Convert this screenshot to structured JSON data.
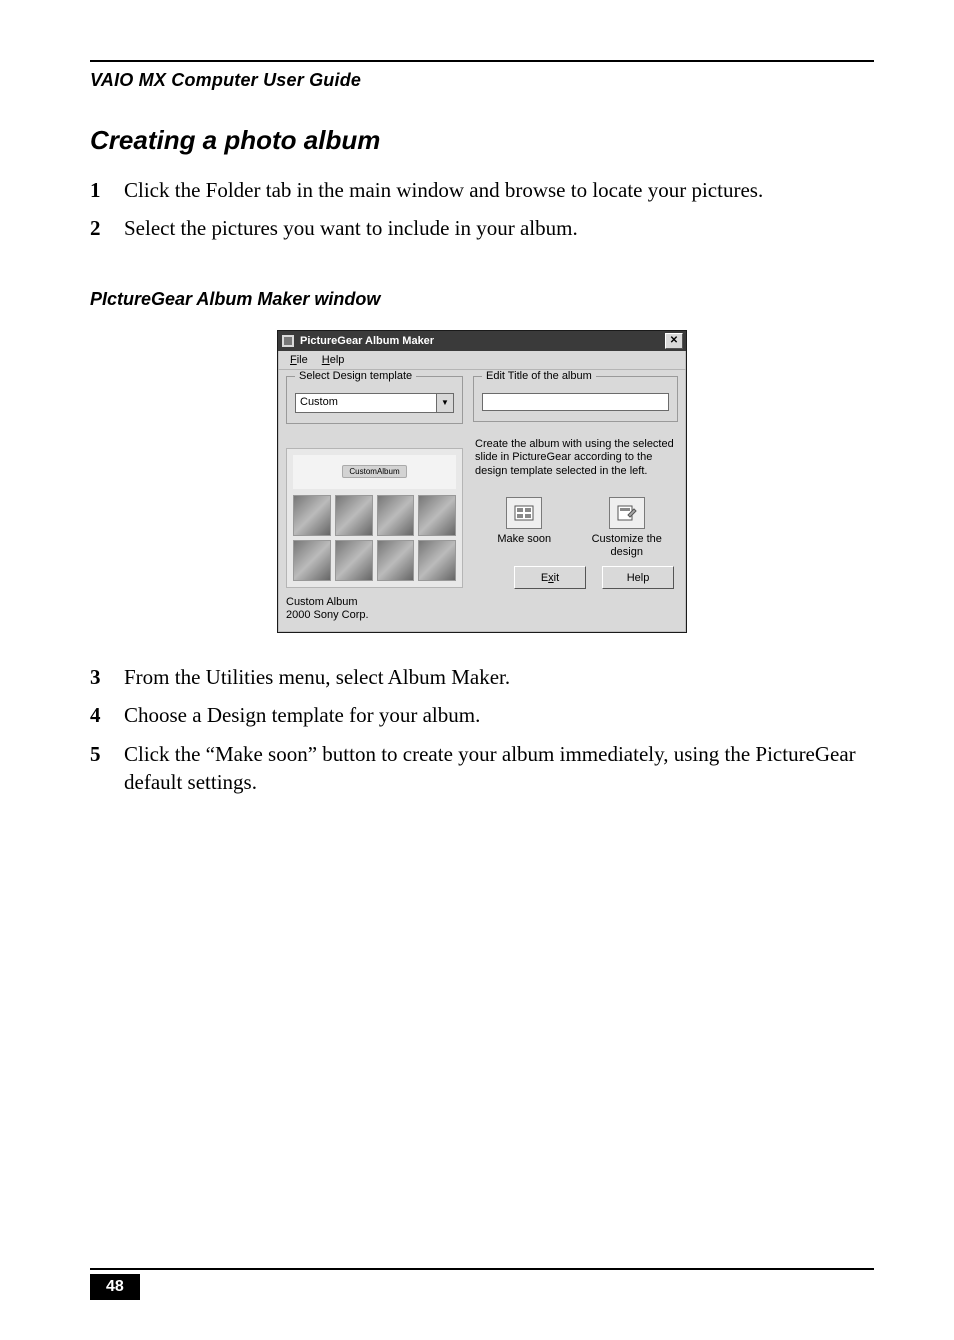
{
  "page": {
    "header": "VAIO MX Computer User Guide",
    "section_title": "Creating a photo album",
    "steps_top": [
      {
        "n": "1",
        "t": "Click the Folder tab in the main window and browse to locate your pictures."
      },
      {
        "n": "2",
        "t": "Select the pictures you want to include in your album."
      }
    ],
    "caption": "PIctureGear Album Maker window",
    "steps_bottom": [
      {
        "n": "3",
        "t": "From the Utilities menu, select Album Maker."
      },
      {
        "n": "4",
        "t": "Choose a Design template for your album."
      },
      {
        "n": "5",
        "t": "Click the “Make soon” button to create your album immediately, using the PictureGear default settings."
      }
    ],
    "page_number": "48"
  },
  "dialog": {
    "title": "PictureGear Album Maker",
    "close_glyph": "✕",
    "menu": {
      "file": "File",
      "file_u": "F",
      "help": "Help",
      "help_u": "H"
    },
    "left": {
      "group_label": "Select Design template",
      "combo_value": "Custom",
      "meta_line1": "Custom Album",
      "meta_line2": "2000 Sony Corp.",
      "pill": "CustomAlbum"
    },
    "right": {
      "group_label": "Edit Title of the album",
      "input_value": "",
      "description": "Create the album with using the selected slide in PictureGear according to the design template selected in the left.",
      "make_soon_label": "Make soon",
      "customize_label": "Customize the design",
      "exit_label": "Exit",
      "exit_u": "x",
      "help_label": "Help"
    }
  }
}
